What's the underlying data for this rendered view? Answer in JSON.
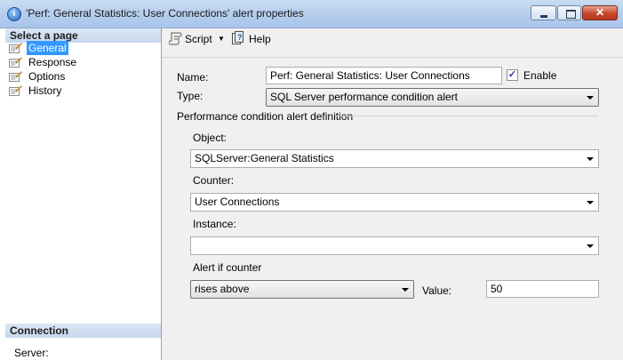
{
  "window": {
    "title": "'Perf: General Statistics: User Connections' alert properties",
    "info_glyph": "i",
    "minimize_icon": "minimize-icon",
    "maximize_icon": "maximize-icon",
    "close_glyph": "✕"
  },
  "sidebar": {
    "select_page_header": "Select a page",
    "pages": [
      {
        "label": "General",
        "selected": true
      },
      {
        "label": "Response",
        "selected": false
      },
      {
        "label": "Options",
        "selected": false
      },
      {
        "label": "History",
        "selected": false
      }
    ],
    "connection_header": "Connection",
    "server_label": "Server:"
  },
  "toolbar": {
    "script_label": "Script",
    "script_dropdown_glyph": "▼",
    "help_label": "Help"
  },
  "form": {
    "name_label": "Name:",
    "name_value": "Perf: General Statistics: User Connections",
    "enable_label": "Enable",
    "enable_checked": "✓",
    "type_label": "Type:",
    "type_value": "SQL Server performance condition alert",
    "group_title": "Performance condition alert definition",
    "object_label": "Object:",
    "object_value": "SQLServer:General Statistics",
    "counter_label": "Counter:",
    "counter_value": "User Connections",
    "instance_label": "Instance:",
    "instance_value": "",
    "alert_if_label": "Alert if counter",
    "condition_value": "rises above",
    "value_label": "Value:",
    "value_value": "50"
  },
  "colors": {
    "selected_page": "#3399ff",
    "titlebar": "#b7cfee",
    "close_button": "#c7462c"
  }
}
